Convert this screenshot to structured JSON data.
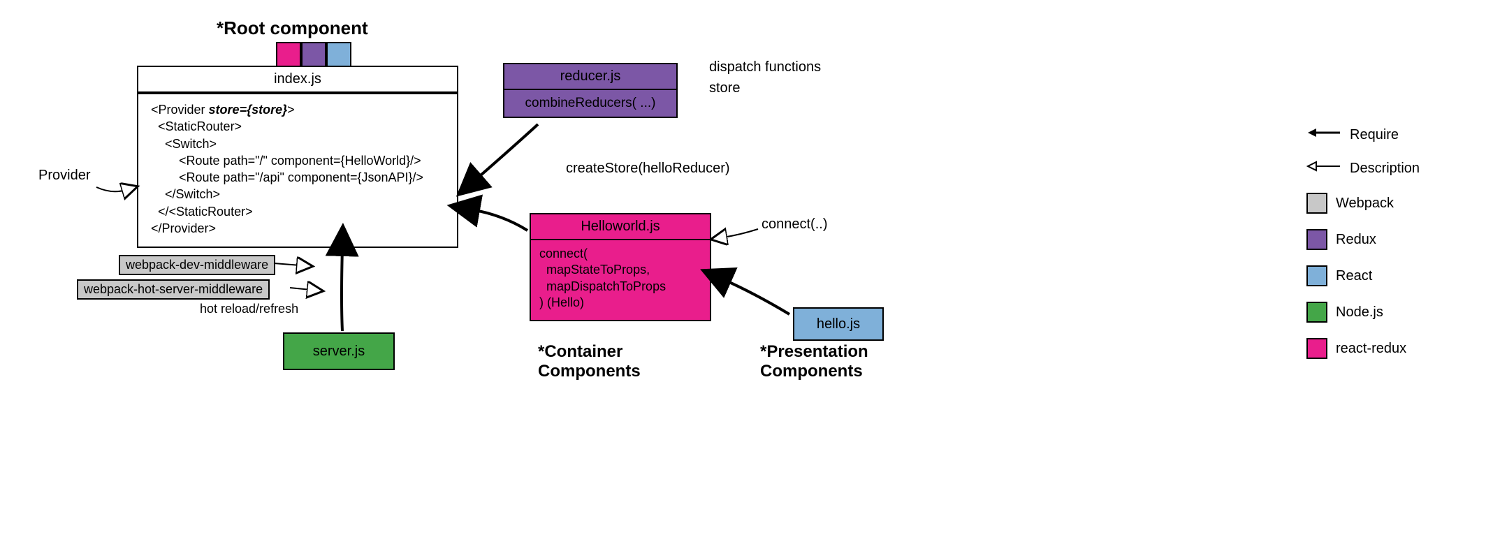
{
  "titles": {
    "root": "*Root component",
    "container": "*Container\nComponents",
    "presentation": "*Presentation\nComponents"
  },
  "boxes": {
    "index": {
      "header": "index.js",
      "code_prefix": "<Provider ",
      "code_bold": "store={store}",
      "code_rest": ">\n  <StaticRouter>\n    <Switch>\n        <Route path=\"/\" component={HelloWorld}/>\n        <Route path=\"/api\" component={JsonAPI}/>\n    </Switch>\n  </<StaticRouter>\n</Provider>"
    },
    "reducer": {
      "header": "reducer.js",
      "body": "combineReducers( ...)"
    },
    "helloworld": {
      "header": "Helloworld.js",
      "body": "connect(\n  mapStateToProps,\n  mapDispatchToProps\n) (Hello)"
    },
    "server": "server.js",
    "hellojs": "hello.js",
    "webpack1": "webpack-dev-middleware",
    "webpack2": "webpack-hot-server-middleware"
  },
  "labels": {
    "provider": "Provider",
    "hot_reload": "hot reload/refresh",
    "dispatch": "dispatch functions",
    "store": "store",
    "create_store": "createStore(helloReducer)",
    "connect": "connect(..)"
  },
  "legend": {
    "require": "Require",
    "description": "Description",
    "webpack": "Webpack",
    "redux": "Redux",
    "react": "React",
    "node": "Node.js",
    "reactredux": "react-redux"
  },
  "colors": {
    "pink": "#e91e8c",
    "purple": "#7c57a6",
    "blue": "#7fb0d9",
    "green": "#44a648",
    "gray": "#c8c8c8"
  }
}
